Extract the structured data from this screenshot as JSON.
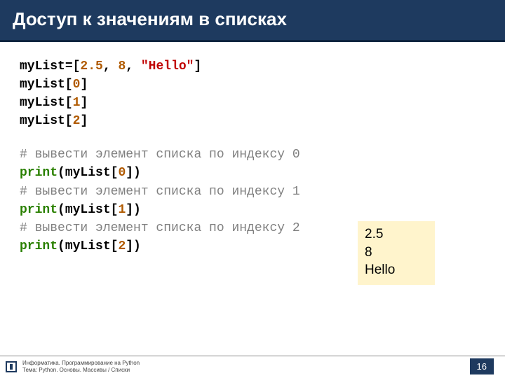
{
  "header": {
    "title": "Доступ к значениям в списках"
  },
  "code": {
    "l1_var": "myList",
    "l1_eq": "=[",
    "l1_n1": "2.5",
    "l1_c1": ", ",
    "l1_n2": "8",
    "l1_c2": ", ",
    "l1_s1": "\"Hello\"",
    "l1_close": "]",
    "l2_a": "myList[",
    "l2_n": "0",
    "l2_b": "]",
    "l3_a": "myList[",
    "l3_n": "1",
    "l3_b": "]",
    "l4_a": "myList[",
    "l4_n": "2",
    "l4_b": "]",
    "c0": "# вывести элемент списка по индексу 0",
    "p0_a": "print",
    "p0_b": "(myList[",
    "p0_n": "0",
    "p0_c": "])",
    "c1": "# вывести элемент списка по индексу 1",
    "p1_a": "print",
    "p1_b": "(myList[",
    "p1_n": "1",
    "p1_c": "])",
    "c2": "# вывести элемент списка по индексу 2",
    "p2_a": "print",
    "p2_b": "(myList[",
    "p2_n": "2",
    "p2_c": "])"
  },
  "output": {
    "o1": "2.5",
    "o2": "8",
    "o3": "Hello"
  },
  "footer": {
    "line1": "Информатика. Программирование на Python",
    "line2": "Тема: Python. Основы. Массивы / Списки",
    "page": "16"
  }
}
